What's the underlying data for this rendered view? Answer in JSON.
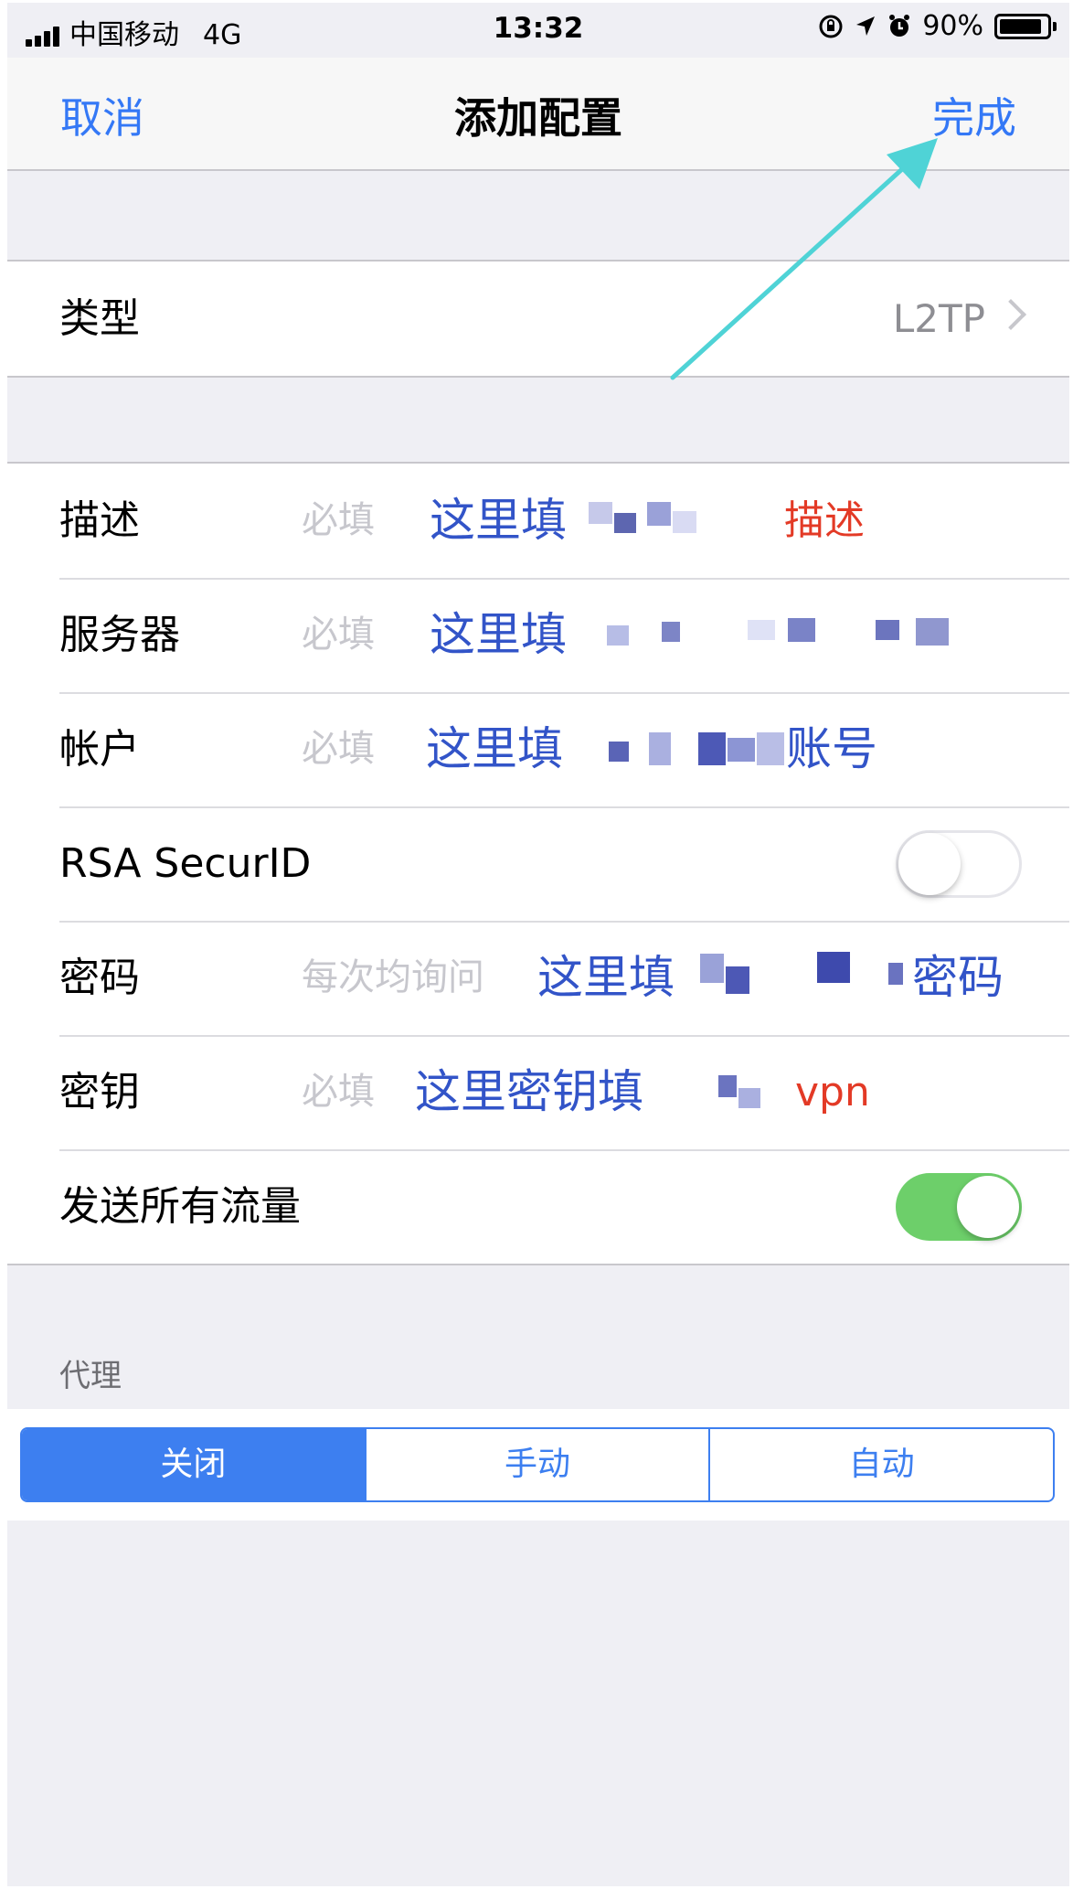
{
  "status_bar": {
    "carrier": "中国移动",
    "network": "4G",
    "time": "13:32",
    "battery": "90%",
    "battery_level": 0.9
  },
  "nav": {
    "cancel_label": "取消",
    "title": "添加配置",
    "done_label": "完成"
  },
  "type_row": {
    "label": "类型",
    "value": "L2TP"
  },
  "fields": [
    {
      "label": "描述",
      "placeholder": "必填",
      "note": "这里填",
      "note_tail": "描述"
    },
    {
      "label": "服务器",
      "placeholder": "必填",
      "note": "这里填"
    },
    {
      "label": "帐户",
      "placeholder": "必填",
      "note": "这里填",
      "note_tail": "账号"
    },
    {
      "label": "RSA SecurID",
      "toggle_on": false
    },
    {
      "label": "密码",
      "placeholder": "每次均询问",
      "note": "这里填",
      "note_tail": "密码"
    },
    {
      "label": "密钥",
      "placeholder": "必填",
      "note": "这里密钥填",
      "note_tail": "vpn"
    },
    {
      "label": "发送所有流量",
      "toggle_on": true
    }
  ],
  "proxy": {
    "header": "代理",
    "options": [
      "关闭",
      "手动",
      "自动"
    ],
    "selected": "关闭"
  },
  "colors": {
    "accent": "#3478f6",
    "toggle_on": "#6dcf6a",
    "note_blue": "#3254c8",
    "note_red": "#e33a26",
    "arrow": "#4fd3d6"
  }
}
